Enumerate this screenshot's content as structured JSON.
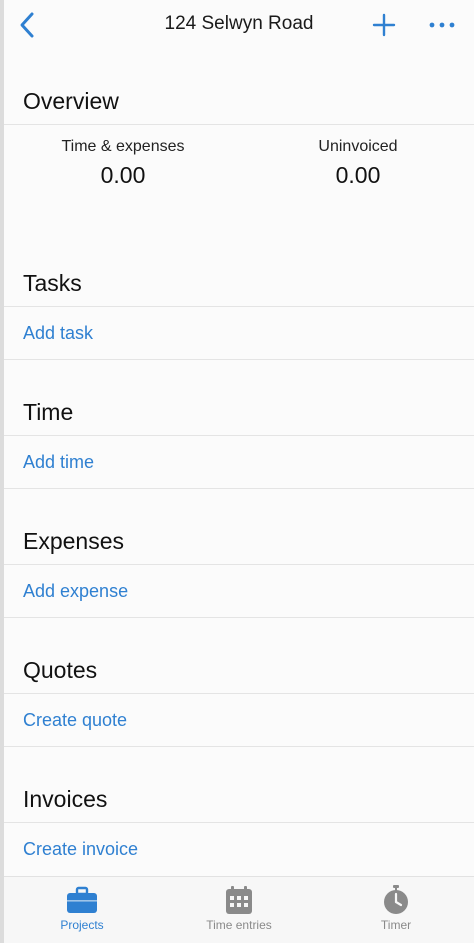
{
  "header": {
    "title": "124 Selwyn Road",
    "back_icon": "chevron-left-icon",
    "add_icon": "plus-icon",
    "more_icon": "ellipsis-icon"
  },
  "overview": {
    "title": "Overview",
    "time_expenses": {
      "label": "Time & expenses",
      "value": "0.00"
    },
    "uninvoiced": {
      "label": "Uninvoiced",
      "value": "0.00"
    }
  },
  "sections": {
    "tasks": {
      "title": "Tasks",
      "action": "Add task"
    },
    "time": {
      "title": "Time",
      "action": "Add time"
    },
    "expenses": {
      "title": "Expenses",
      "action": "Add expense"
    },
    "quotes": {
      "title": "Quotes",
      "action": "Create quote"
    },
    "invoices": {
      "title": "Invoices",
      "action": "Create invoice"
    }
  },
  "tabbar": {
    "active_tab": "Projects",
    "tabs": [
      {
        "label": "Projects",
        "icon": "briefcase-icon"
      },
      {
        "label": "Time entries",
        "icon": "calendar-icon"
      },
      {
        "label": "Timer",
        "icon": "stopwatch-icon"
      }
    ]
  },
  "colors": {
    "accent": "#2f80d1",
    "inactive": "#8a8a8a",
    "background": "#fbfbfb",
    "divider": "#e4e4e4"
  }
}
